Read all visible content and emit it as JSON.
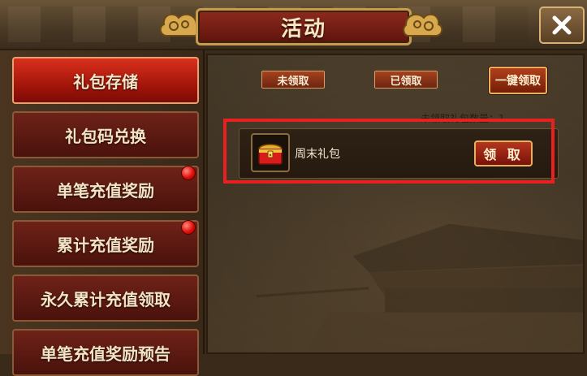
{
  "header": {
    "title": "活动",
    "close_icon": "close-icon"
  },
  "sidebar": {
    "items": [
      {
        "label": "礼包存储",
        "active": true,
        "badge": false
      },
      {
        "label": "礼包码兑换",
        "active": false,
        "badge": false
      },
      {
        "label": "单笔充值奖励",
        "active": false,
        "badge": true
      },
      {
        "label": "累计充值奖励",
        "active": false,
        "badge": true
      },
      {
        "label": "永久累计充值领取",
        "active": false,
        "badge": false
      },
      {
        "label": "单笔充值奖励预告",
        "active": false,
        "badge": false
      }
    ]
  },
  "main": {
    "tabs": {
      "unclaimed": "未领取",
      "claimed": "已领取",
      "claim_all": "一键领取"
    },
    "unclaimed_count": "未领取礼包数量：1",
    "gifts": [
      {
        "name": "周末礼包",
        "icon": "treasure-chest-icon",
        "claim_label": "领 取"
      }
    ]
  },
  "colors": {
    "active_tab": "#c8200e",
    "highlight": "#e82020",
    "badge": "#e0100a"
  }
}
